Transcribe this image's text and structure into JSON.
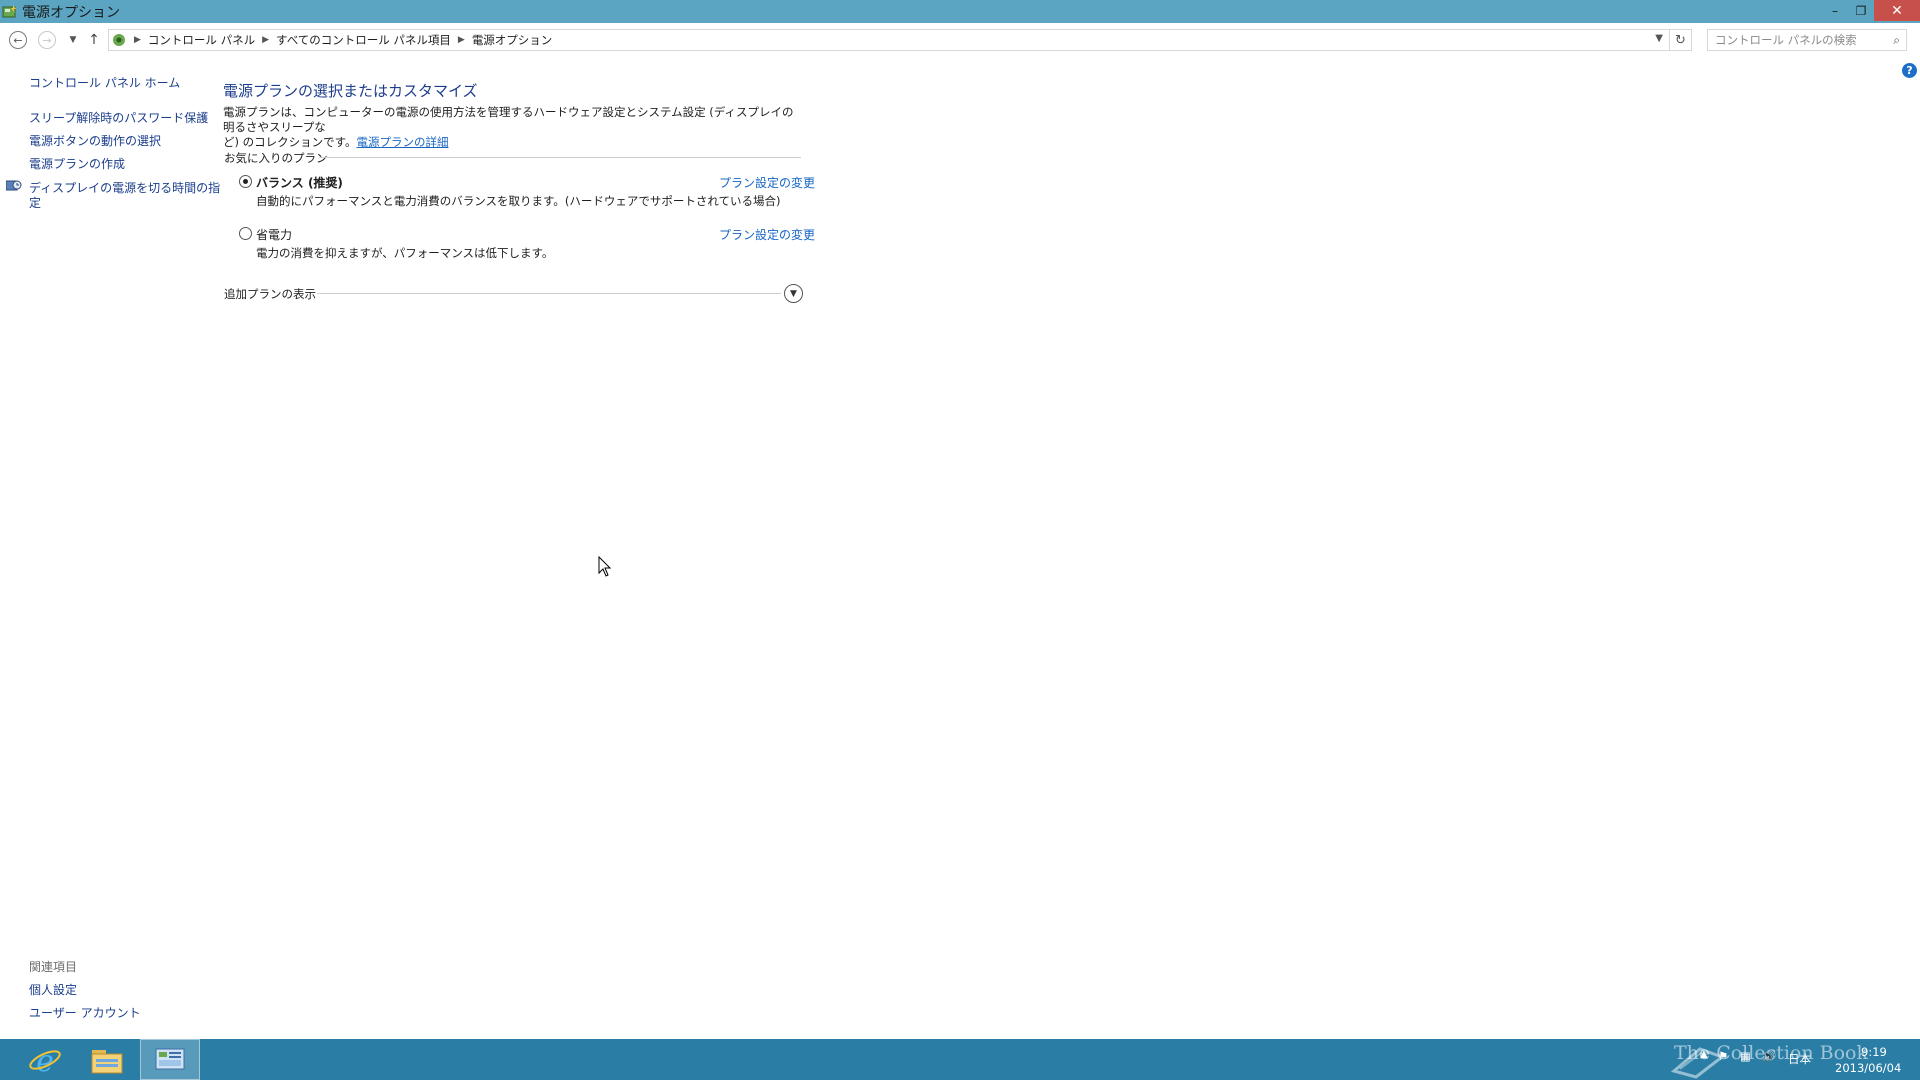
{
  "window": {
    "title": "電源オプション",
    "minimize": "–",
    "maximize": "❐",
    "close": "✕"
  },
  "address": {
    "breadcrumbs": [
      "コントロール パネル",
      "すべてのコントロール パネル項目",
      "電源オプション"
    ],
    "search_placeholder": "コントロール パネルの検索"
  },
  "sidebar": {
    "home": "コントロール パネル ホーム",
    "links": [
      "スリープ解除時のパスワード保護",
      "電源ボタンの動作の選択",
      "電源プランの作成",
      "ディスプレイの電源を切る時間の指",
      "定"
    ],
    "related_title": "関連項目",
    "related": [
      "個人設定",
      "ユーザー アカウント"
    ]
  },
  "main": {
    "heading": "電源プランの選択またはカスタマイズ",
    "description_line1": "電源プランは、コンピューターの電源の使用方法を管理するハードウェア設定とシステム設定 (ディスプレイの明るさやスリープな",
    "description_line2": "ど) のコレクションです。",
    "details_link": "電源プランの詳細",
    "favorites_header": "お気に入りのプラン",
    "plans": [
      {
        "name": "バランス (推奨)",
        "description": "自動的にパフォーマンスと電力消費のバランスを取ります。(ハードウェアでサポートされている場合)",
        "link": "プラン設定の変更",
        "selected": true
      },
      {
        "name": "省電力",
        "description": "電力の消費を抑えますが、パフォーマンスは低下します。",
        "link": "プラン設定の変更",
        "selected": false
      }
    ],
    "additional_header": "追加プランの表示"
  },
  "taskbar": {
    "apps": [
      "internet-explorer",
      "file-explorer",
      "control-panel"
    ],
    "active_app": "control-panel",
    "language": "日本",
    "time": "9:19",
    "date": "2013/06/04",
    "watermark": "The Collection Book"
  },
  "colors": {
    "titlebar": "#5ba5c3",
    "taskbar": "#2a7ea6",
    "link": "#1766c4",
    "heading": "#1e3e8c",
    "close": "#c7504a"
  }
}
